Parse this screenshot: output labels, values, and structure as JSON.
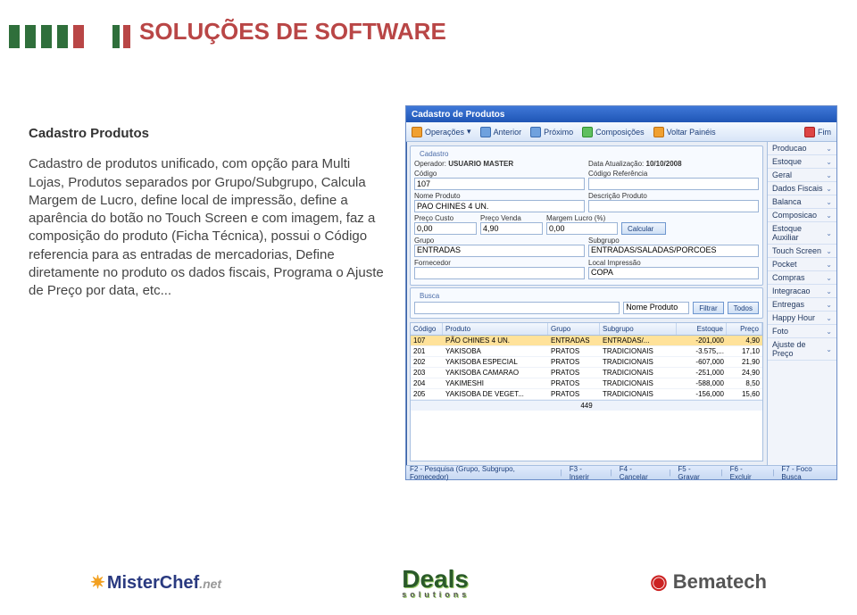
{
  "slide": {
    "title": "SOLUÇÕES DE SOFTWARE",
    "subtitle": "Cadastro Produtos",
    "body": "Cadastro de produtos unificado, com opção para Multi Lojas, Produtos separados por Grupo/Subgrupo, Calcula Margem de Lucro, define local de impressão, define a aparência do botão no Touch Screen e com imagem, faz a composição do produto (Ficha Técnica), possui o Código referencia para as entradas de mercadorias, Define diretamente no produto os dados fiscais, Programa o Ajuste de Preço por data, etc..."
  },
  "app": {
    "title": "Cadastro de Produtos",
    "toolbar": {
      "operacoes": "Operações",
      "anterior": "Anterior",
      "proximo": "Próximo",
      "composicoes": "Composições",
      "voltar": "Voltar Painéis",
      "fim": "Fim"
    },
    "cadastro": {
      "legend": "Cadastro",
      "operador_label": "Operador:",
      "operador": "USUARIO MASTER",
      "data_label": "Data Atualização:",
      "data": "10/10/2008",
      "codigo_label": "Código",
      "codigo": "107",
      "codref_label": "Código Referência",
      "codref": "",
      "nome_label": "Nome Produto",
      "nome": "PAO CHINES 4 UN.",
      "desc_label": "Descrição Produto",
      "desc": "",
      "pcusto_label": "Preço Custo",
      "pcusto": "0,00",
      "pvenda_label": "Preço Venda",
      "pvenda": "4,90",
      "margem_label": "Margem Lucro (%)",
      "margem": "0,00",
      "calcular": "Calcular",
      "grupo_label": "Grupo",
      "grupo": "ENTRADAS",
      "subgrupo_label": "Subgrupo",
      "subgrupo": "ENTRADAS/SALADAS/PORCOES",
      "fornecedor_label": "Fornecedor",
      "fornecedor": "",
      "localimp_label": "Local Impressão",
      "localimp": "COPA"
    },
    "busca": {
      "legend": "Busca",
      "field_label": "Nome Produto",
      "filtrar": "Filtrar",
      "todos": "Todos"
    },
    "grid": {
      "headers": [
        "Código",
        "Produto",
        "Grupo",
        "Subgrupo",
        "Estoque",
        "Preço"
      ],
      "rows": [
        {
          "cod": "107",
          "prod": "PÃO CHINES 4 UN.",
          "grp": "ENTRADAS",
          "sub": "ENTRADAS/...",
          "est": "-201,000",
          "prc": "4,90",
          "sel": true
        },
        {
          "cod": "201",
          "prod": "YAKISOBA",
          "grp": "PRATOS",
          "sub": "TRADICIONAIS",
          "est": "-3.575,...",
          "prc": "17,10"
        },
        {
          "cod": "202",
          "prod": "YAKISOBA ESPECIAL",
          "grp": "PRATOS",
          "sub": "TRADICIONAIS",
          "est": "-607,000",
          "prc": "21,90"
        },
        {
          "cod": "203",
          "prod": "YAKISOBA CAMARAO",
          "grp": "PRATOS",
          "sub": "TRADICIONAIS",
          "est": "-251,000",
          "prc": "24,90"
        },
        {
          "cod": "204",
          "prod": "YAKIMESHI",
          "grp": "PRATOS",
          "sub": "TRADICIONAIS",
          "est": "-588,000",
          "prc": "8,50"
        },
        {
          "cod": "205",
          "prod": "YAKISOBA DE VEGET...",
          "grp": "PRATOS",
          "sub": "TRADICIONAIS",
          "est": "-156,000",
          "prc": "15,60"
        }
      ],
      "footer": "449"
    },
    "side_panels": [
      "Producao",
      "Estoque",
      "Geral",
      "Dados Fiscais",
      "Balanca",
      "Composicao",
      "Estoque Auxiliar",
      "Touch Screen",
      "Pocket",
      "Compras",
      "Integracao",
      "Entregas",
      "Happy Hour",
      "Foto",
      "Ajuste de Preço"
    ],
    "status": {
      "f2": "F2 - Pesquisa (Grupo, Subgrupo, Fornecedor)",
      "f3": "F3 - Inserir",
      "f4": "F4 - Cancelar",
      "f5": "F5 - Gravar",
      "f6": "F6 - Excluir",
      "f7": "F7 - Foco Busca"
    }
  },
  "logos": {
    "misterchef": "MisterChef",
    "misterchef_net": ".net",
    "deals": "Deals",
    "deals_sub": "solutions",
    "bematech": "Bematech"
  }
}
